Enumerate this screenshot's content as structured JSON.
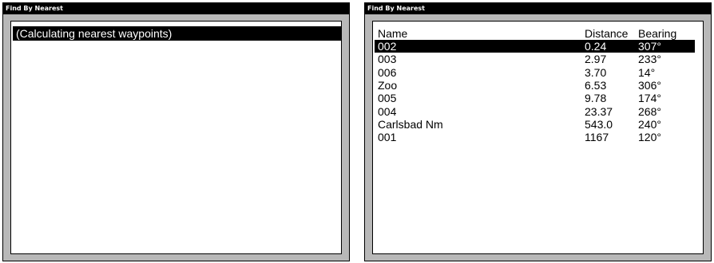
{
  "left_window": {
    "title": "Find By Nearest",
    "status_text": "(Calculating nearest waypoints)"
  },
  "right_window": {
    "title": "Find By Nearest",
    "columns": {
      "name": "Name",
      "distance": "Distance",
      "bearing": "Bearing"
    },
    "selected_index": 0,
    "rows": [
      {
        "name": "002",
        "distance": "0.24",
        "bearing": "307°"
      },
      {
        "name": "003",
        "distance": "2.97",
        "bearing": "233°"
      },
      {
        "name": "006",
        "distance": "3.70",
        "bearing": "14°"
      },
      {
        "name": "Zoo",
        "distance": "6.53",
        "bearing": "306°"
      },
      {
        "name": "005",
        "distance": "9.78",
        "bearing": "174°"
      },
      {
        "name": "004",
        "distance": "23.37",
        "bearing": "268°"
      },
      {
        "name": "Carlsbad Nm",
        "distance": "543.0",
        "bearing": "240°"
      },
      {
        "name": "001",
        "distance": "1167",
        "bearing": "120°"
      }
    ]
  }
}
